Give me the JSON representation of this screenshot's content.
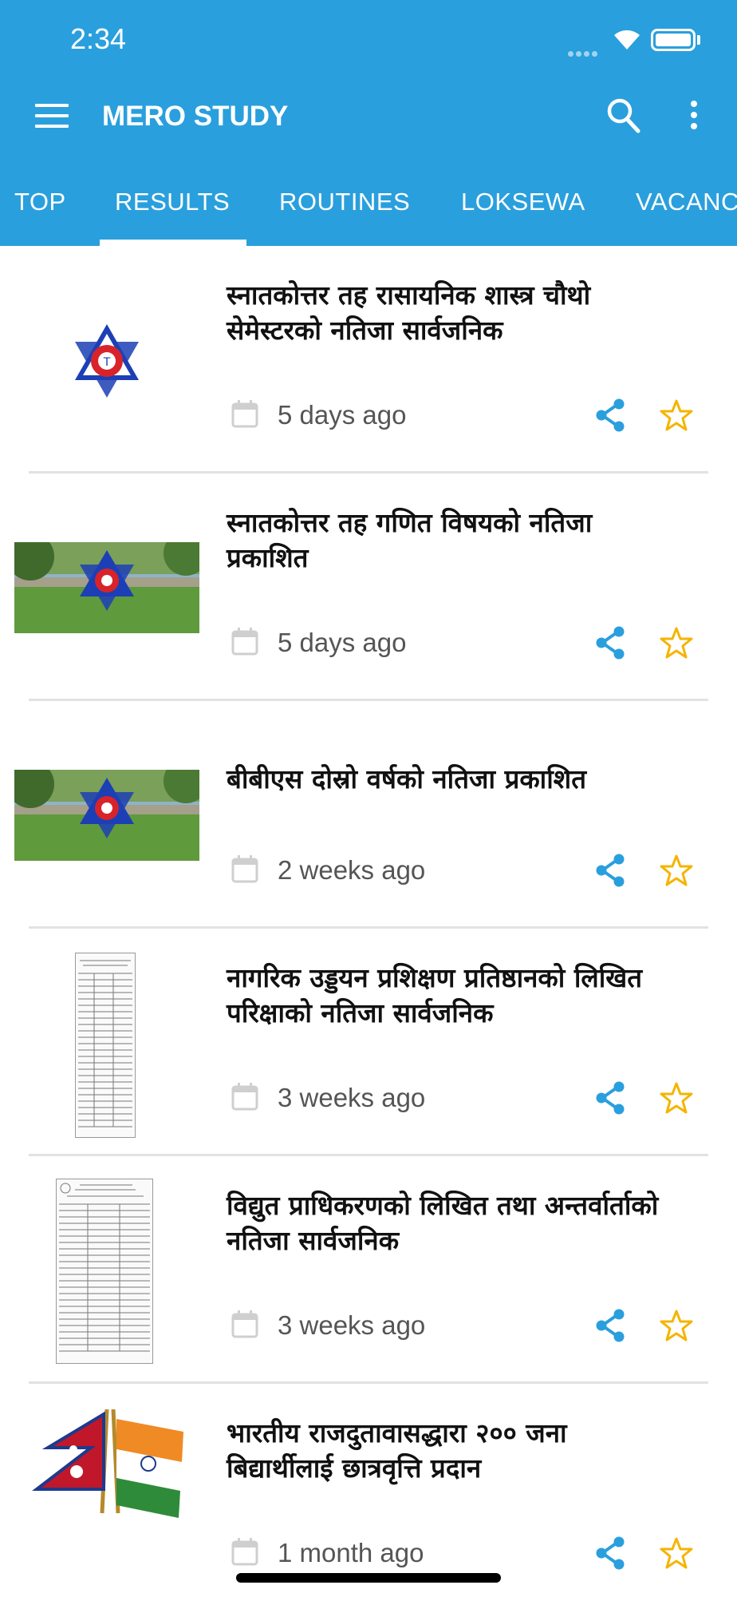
{
  "status_bar": {
    "time": "2:34"
  },
  "app_bar": {
    "title": "MERO STUDY"
  },
  "tabs": [
    {
      "label": "TOP"
    },
    {
      "label": "RESULTS"
    },
    {
      "label": "ROUTINES"
    },
    {
      "label": "LOKSEWA"
    },
    {
      "label": "VACANC"
    }
  ],
  "active_tab": "RESULTS",
  "colors": {
    "primary": "#2a9fdd",
    "share": "#2a9fdd",
    "star": "#f5b400",
    "divider": "#e2e2e2"
  },
  "articles": [
    {
      "title": "स्नातकोत्तर तह रासायनिक शास्त्र चौथो सेमेस्टरको नतिजा सार्वजनिक",
      "date": "5 days ago",
      "thumbnail": "tu-logo"
    },
    {
      "title": "स्नातकोत्तर तह गणित विषयको नतिजा प्रकाशित",
      "date": "5 days ago",
      "thumbnail": "tu-campus-photo"
    },
    {
      "title": "बीबीएस दोस्रो वर्षको नतिजा प्रकाशित",
      "date": "2 weeks ago",
      "thumbnail": "tu-campus-photo"
    },
    {
      "title": "नागरिक उड्डयन प्रशिक्षण प्रतिष्ठानको लिखित परिक्षाको नतिजा सार्वजनिक",
      "date": "3 weeks ago",
      "thumbnail": "result-document"
    },
    {
      "title": "विद्युत प्राधिकरणको लिखित तथा अन्तर्वार्ताको नतिजा सार्वजनिक",
      "date": "3 weeks ago",
      "thumbnail": "result-document"
    },
    {
      "title": "भारतीय राजदुतावासद्धारा २०० जना बिद्यार्थीलाई छात्रवृत्ति प्रदान",
      "date": "1 month ago",
      "thumbnail": "nepal-india-flags"
    }
  ]
}
